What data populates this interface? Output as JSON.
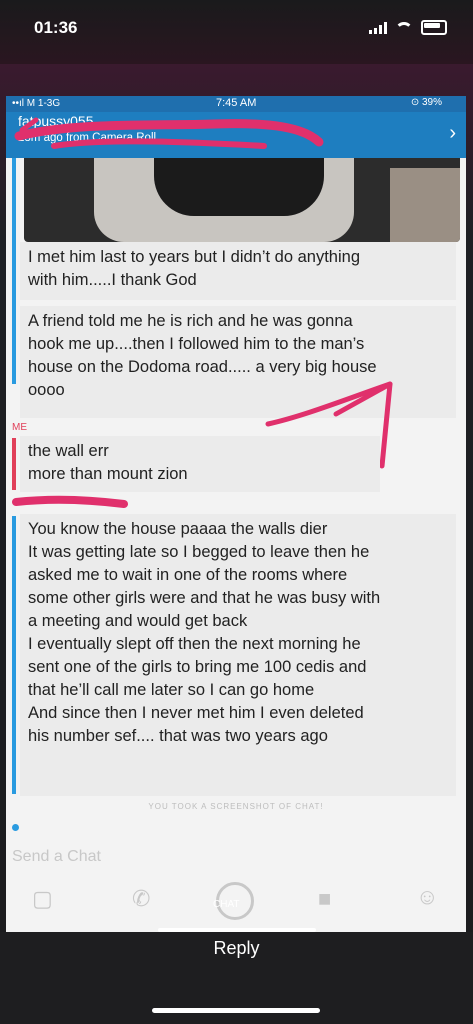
{
  "outer_status": {
    "time": "01:36"
  },
  "inner_status": {
    "left": "••ıl M 1-3G",
    "time": "7:45 AM",
    "battery": "⊙ 39%"
  },
  "chat_header": {
    "username": "fatpussy055",
    "subtitle": "28m ago from Camera Roll"
  },
  "messages": [
    {
      "sender": "them",
      "lines": [
        "I met him last to years but I didn’t do anything",
        "with him.....I thank God"
      ]
    },
    {
      "sender": "them",
      "lines": [
        "A friend told me he is rich and he was gonna",
        "hook me up....then I followed him to the man’s",
        "house on the Dodoma road..... a very big house",
        "oooo"
      ]
    },
    {
      "sender": "me",
      "label": "ME",
      "lines": [
        "the wall err",
        "more than mount zion"
      ]
    },
    {
      "sender": "them",
      "lines": [
        "You know the house paaaa the walls dier",
        "It was getting late so I begged to leave then he",
        "asked me to wait in one of the rooms where",
        "some other girls were and that he was busy with",
        "a meeting and would get back",
        "I eventually slept off then the next morning he",
        "sent one of the girls to bring me 100 cedis and",
        "that he’ll call me later so I can go home",
        "And since then I never met him I even deleted",
        "his number sef.... that was two years ago"
      ]
    }
  ],
  "screenshot_notice": "YOU TOOK A SCREENSHOT OF CHAT!",
  "composer": {
    "placeholder": "Send a Chat"
  },
  "toolbar": {
    "chat_label": "CHAT"
  },
  "reply_label": "Reply",
  "colors": {
    "accent": "#1e7ec0",
    "me": "#e1405a",
    "scribble": "#e0306c"
  }
}
